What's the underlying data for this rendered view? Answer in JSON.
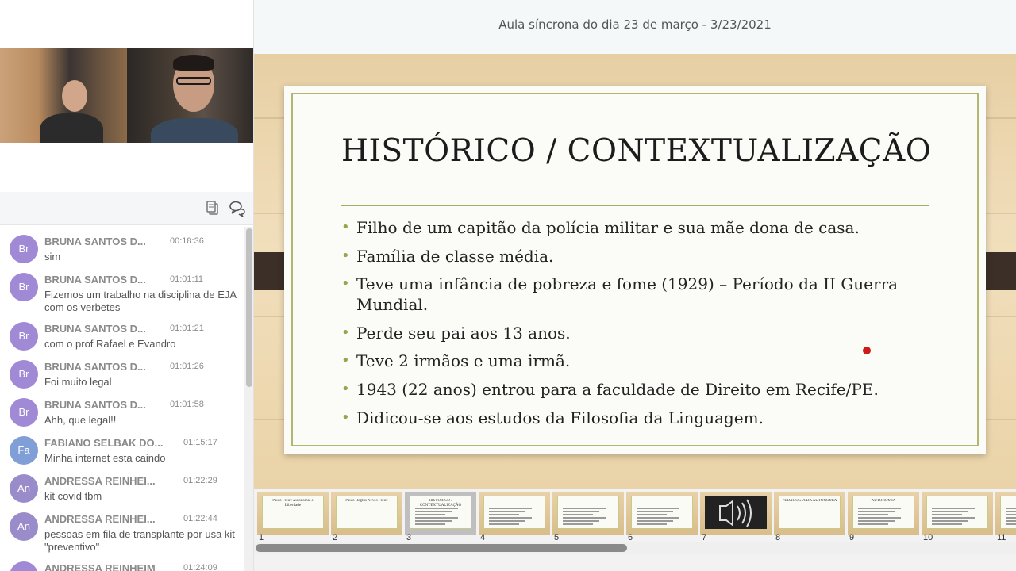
{
  "presentation": {
    "title": "Aula síncrona do dia 23 de março - 3/23/2021"
  },
  "slide": {
    "title": "HISTÓRICO / CONTEXTUALIZAÇÃO",
    "bullets": [
      "Filho de um capitão da polícia militar e sua mãe dona de casa.",
      "Família de classe média.",
      "Teve uma infância de pobreza e fome (1929) – Período da II Guerra Mundial.",
      "Perde seu pai aos 13 anos.",
      "Teve 2 irmãos e uma irmã.",
      "1943 (22 anos) entrou para a faculdade de Direito em Recife/PE.",
      "Didicou-se aos estudos da Filosofia da Linguagem."
    ]
  },
  "chat": {
    "icons": [
      "copy-icon",
      "chat-bubbles-icon"
    ],
    "messages": [
      {
        "initials": "Br",
        "name": "BRUNA SANTOS D...",
        "time": "00:18:36",
        "text": "sim"
      },
      {
        "initials": "Br",
        "name": "BRUNA SANTOS D...",
        "time": "01:01:11",
        "text": "Fizemos um trabalho na disciplina de EJA com os verbetes"
      },
      {
        "initials": "Br",
        "name": "BRUNA SANTOS D...",
        "time": "01:01:21",
        "text": "com o prof Rafael e Evandro"
      },
      {
        "initials": "Br",
        "name": "BRUNA SANTOS D...",
        "time": "01:01:26",
        "text": "Foi muito legal"
      },
      {
        "initials": "Br",
        "name": "BRUNA SANTOS D...",
        "time": "01:01:58",
        "text": "Ahh, que legal!!"
      },
      {
        "initials": "Fa",
        "name": "FABIANO SELBAK DO...",
        "time": "01:15:17",
        "text": "Minha internet esta caindo"
      },
      {
        "initials": "An",
        "name": "ANDRESSA REINHEI...",
        "time": "01:22:29",
        "text": "kit covid tbm"
      },
      {
        "initials": "An",
        "name": "ANDRESSA REINHEI...",
        "time": "01:22:44",
        "text": "pessoas em fila de transplante por usa kit \"preventivo\""
      },
      {
        "initials": "",
        "name": "ANDRESSA REINHEIM",
        "time": "01:24:09",
        "text": ""
      }
    ]
  },
  "thumbnails": {
    "numbers": [
      "1",
      "2",
      "3",
      "4",
      "5",
      "6",
      "7",
      "8",
      "9",
      "10",
      "11"
    ],
    "selected": "3",
    "labels": {
      "t1": "Paulo Freire Autonomia e Liberdade",
      "t2": "Paulo Reglus Neves Freire",
      "t3": "HISTÓRICO / CONTEXTUALIZAÇÃO",
      "t8": "PEDAGOGIA DA AUTONOMIA",
      "t9": "AUTONOMIA"
    }
  }
}
